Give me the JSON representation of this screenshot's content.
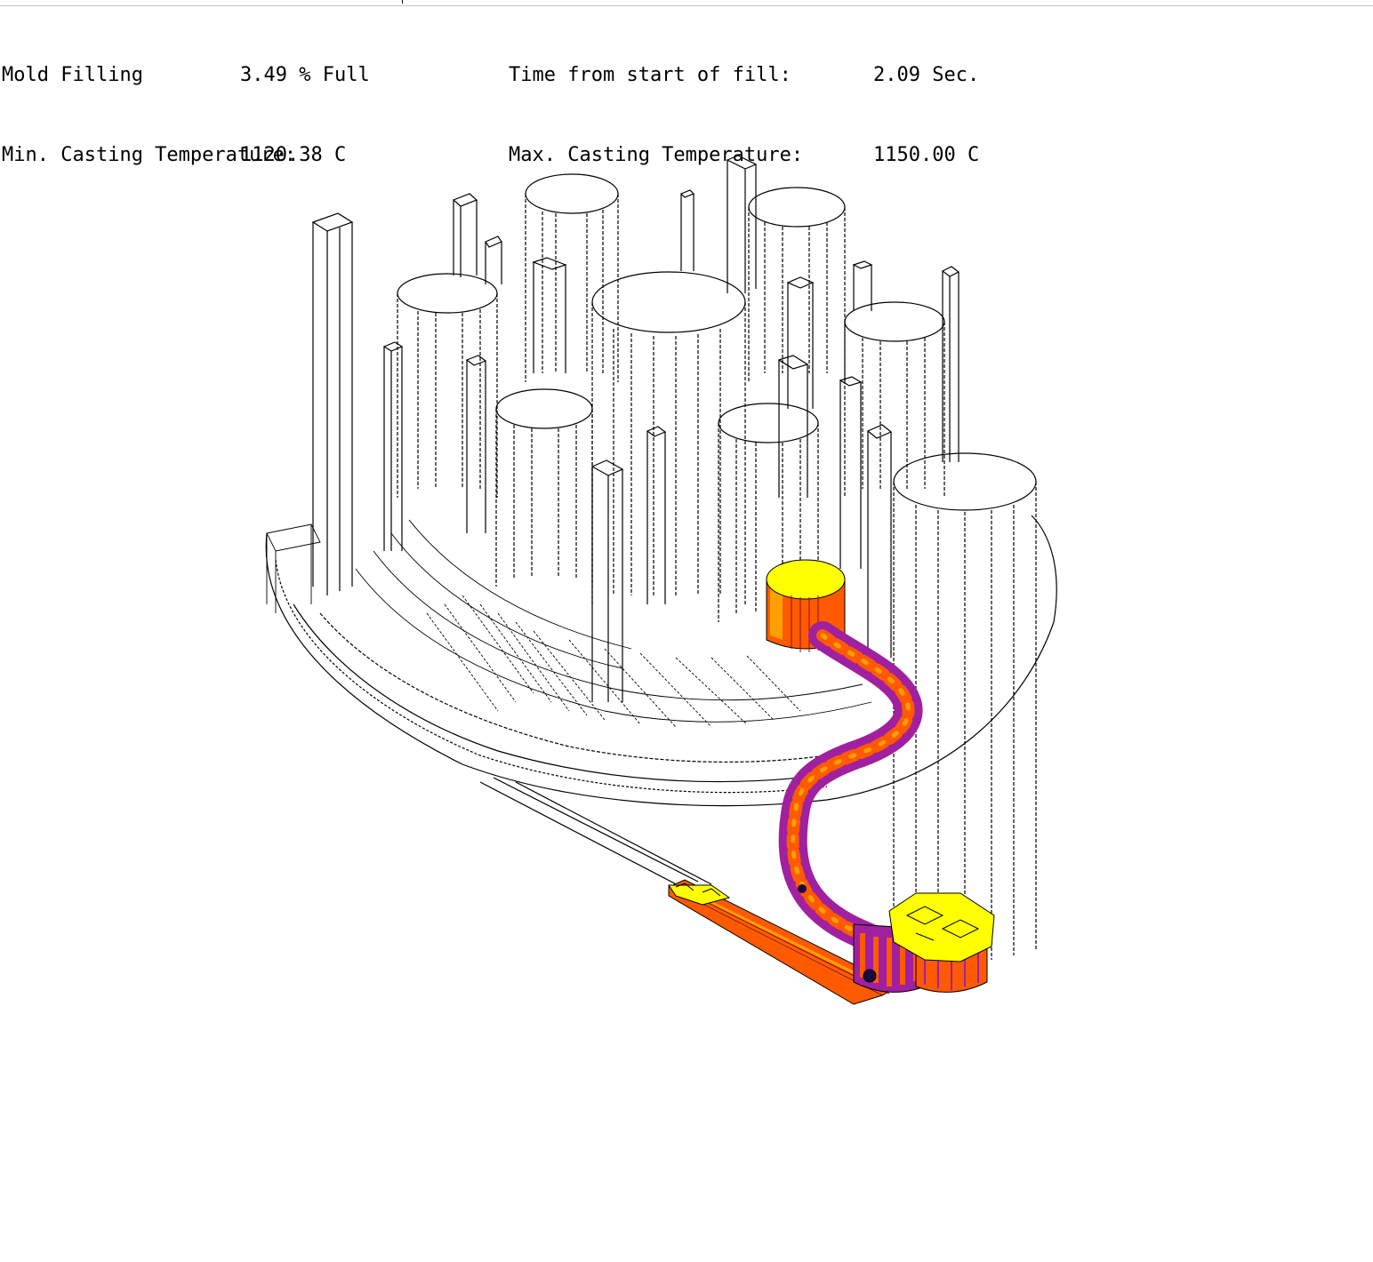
{
  "status": {
    "fill_label": "Mold Filling",
    "fill_value": "3.49 % Full",
    "time_label": "Time from start of fill:",
    "time_value": "2.09 Sec.",
    "min_temp_label": "Min. Casting Temperature:",
    "min_temp_value": "1120.38 C",
    "max_temp_label": "Max. Casting Temperature:",
    "max_temp_value": "1150.00 C"
  },
  "simulation": {
    "fill_fraction": 0.0349,
    "colors": {
      "outline": "#000000",
      "metal_hot": "#ffff00",
      "metal_warm": "#ffa000",
      "metal_mid": "#ff5a00",
      "metal_cool": "#a020a0",
      "metal_cold": "#1a0a40"
    }
  }
}
